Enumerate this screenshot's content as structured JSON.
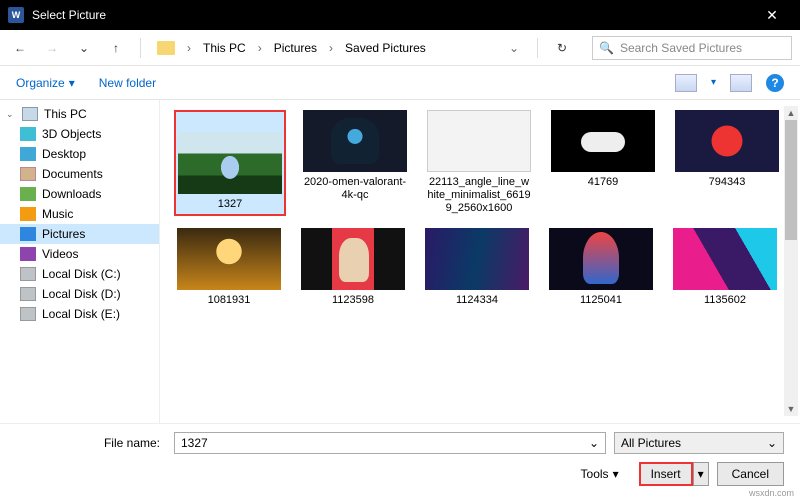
{
  "titlebar": {
    "title": "Select Picture"
  },
  "breadcrumb": {
    "root": "This PC",
    "level1": "Pictures",
    "level2": "Saved Pictures"
  },
  "search": {
    "placeholder": "Search Saved Pictures"
  },
  "toolbar": {
    "organize": "Organize",
    "new_folder": "New folder",
    "help_glyph": "?"
  },
  "sidebar": {
    "items": [
      {
        "label": "This PC"
      },
      {
        "label": "3D Objects"
      },
      {
        "label": "Desktop"
      },
      {
        "label": "Documents"
      },
      {
        "label": "Downloads"
      },
      {
        "label": "Music"
      },
      {
        "label": "Pictures"
      },
      {
        "label": "Videos"
      },
      {
        "label": "Local Disk (C:)"
      },
      {
        "label": "Local Disk (D:)"
      },
      {
        "label": "Local Disk (E:)"
      }
    ]
  },
  "files": [
    {
      "label": "1327"
    },
    {
      "label": "2020-omen-valorant-4k-qc"
    },
    {
      "label": "22113_angle_line_white_minimalist_66199_2560x1600"
    },
    {
      "label": "41769"
    },
    {
      "label": "794343"
    },
    {
      "label": "1081931"
    },
    {
      "label": "1123598"
    },
    {
      "label": "1124334"
    },
    {
      "label": "1125041"
    },
    {
      "label": "1135602"
    }
  ],
  "footer": {
    "file_label": "File name:",
    "file_value": "1327",
    "filter": "All Pictures",
    "tools": "Tools",
    "insert": "Insert",
    "cancel": "Cancel"
  },
  "watermark": "wsxdn.com"
}
